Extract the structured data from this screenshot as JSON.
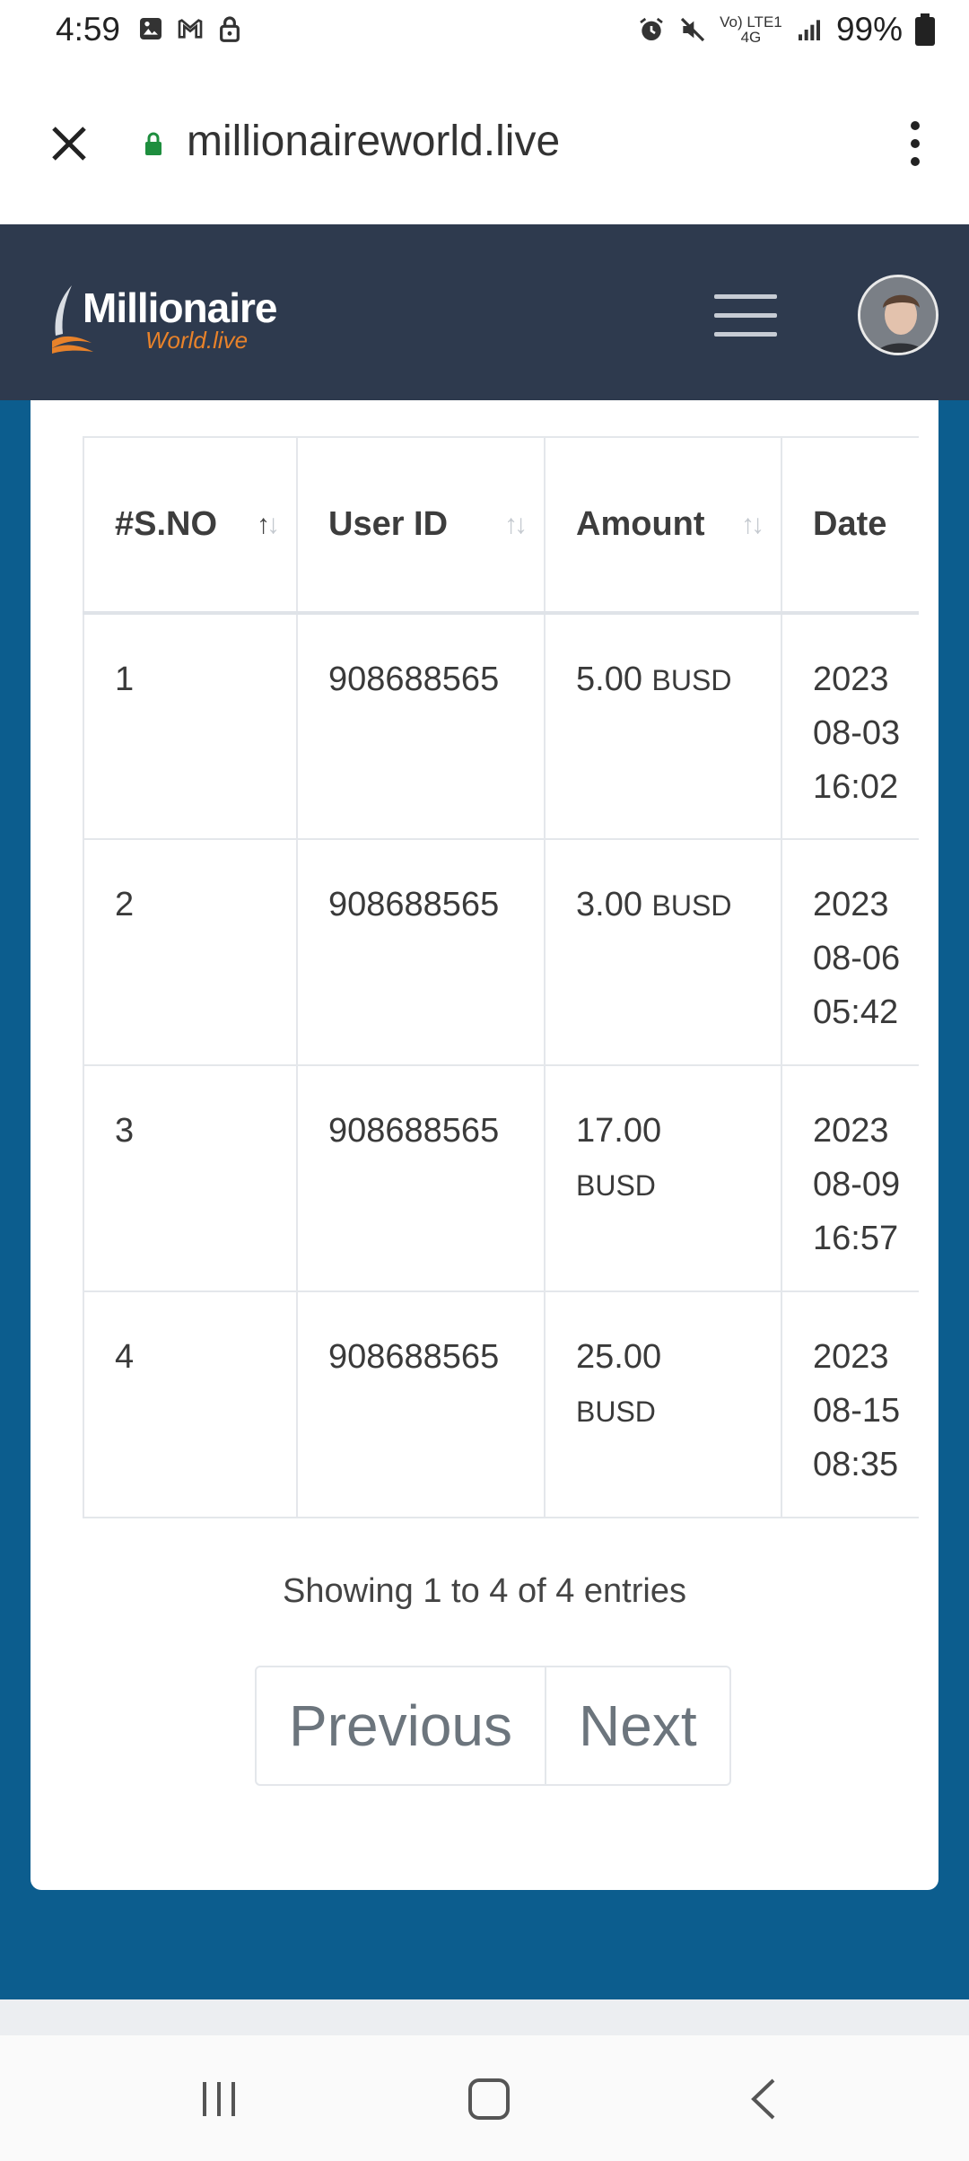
{
  "status_bar": {
    "time": "4:59",
    "battery": "99%",
    "network": "Vo) LTE1 4G"
  },
  "browser": {
    "url": "millionaireworld.live"
  },
  "header": {
    "logo_main": "Millionaire",
    "logo_sub": "World.live"
  },
  "table": {
    "columns": [
      "#S.NO",
      "User ID",
      "Amount",
      "Date"
    ],
    "rows": [
      {
        "sno": "1",
        "user_id": "908688565",
        "amount": "5.00",
        "unit": "BUSD",
        "date": [
          "2023",
          "08-03",
          "16:02"
        ]
      },
      {
        "sno": "2",
        "user_id": "908688565",
        "amount": "3.00",
        "unit": "BUSD",
        "date": [
          "2023",
          "08-06",
          "05:42"
        ]
      },
      {
        "sno": "3",
        "user_id": "908688565",
        "amount": "17.00",
        "unit": "BUSD",
        "date": [
          "2023",
          "08-09",
          "16:57"
        ]
      },
      {
        "sno": "4",
        "user_id": "908688565",
        "amount": "25.00",
        "unit": "BUSD",
        "date": [
          "2023",
          "08-15",
          "08:35"
        ]
      }
    ]
  },
  "pagination": {
    "info": "Showing 1 to 4 of 4 entries",
    "previous": "Previous",
    "next": "Next"
  },
  "colors": {
    "header_bg": "#2e3a4e",
    "page_bg": "#0c5d8e",
    "logo_accent": "#e8822a"
  }
}
